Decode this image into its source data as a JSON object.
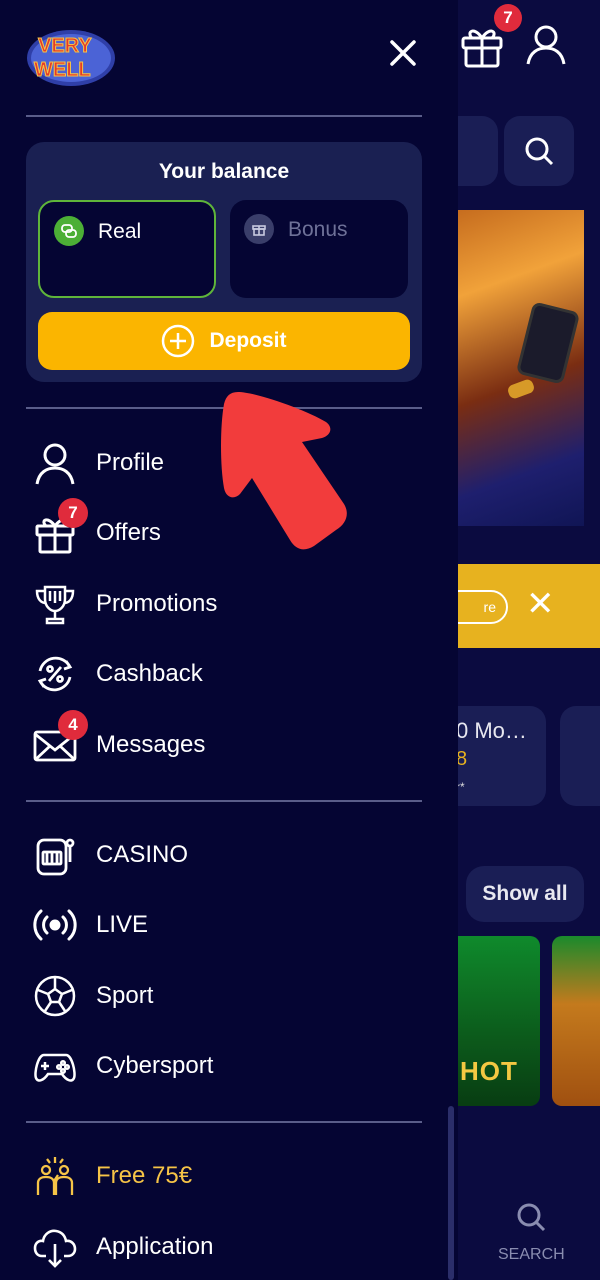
{
  "background": {
    "header": {
      "gift_badge": "7"
    },
    "promo": {
      "pill_text": "re"
    },
    "game_card": {
      "title": "0 Mo…",
      "value": "8",
      "note": "r*"
    },
    "show_all": "Show all",
    "game_tile_text": "HOT",
    "bottom_nav": {
      "search_label": "SEARCH"
    }
  },
  "drawer": {
    "logo_text": "VERY WELL",
    "balance": {
      "title": "Your balance",
      "real_label": "Real",
      "bonus_label": "Bonus",
      "deposit_label": "Deposit"
    },
    "menu_account": [
      {
        "label": "Profile",
        "icon": "user-icon"
      },
      {
        "label": "Offers",
        "icon": "gift-icon",
        "badge": "7"
      },
      {
        "label": "Promotions",
        "icon": "trophy-icon"
      },
      {
        "label": "Cashback",
        "icon": "cashback-icon"
      },
      {
        "label": "Messages",
        "icon": "envelope-icon",
        "badge": "4"
      }
    ],
    "menu_sections": [
      {
        "label": "CASINO",
        "icon": "slot-machine-icon"
      },
      {
        "label": "LIVE",
        "icon": "broadcast-icon"
      },
      {
        "label": "Sport",
        "icon": "soccer-ball-icon"
      },
      {
        "label": "Cybersport",
        "icon": "gamepad-icon"
      }
    ],
    "menu_extra": [
      {
        "label": "Free 75€",
        "icon": "celebration-icon"
      },
      {
        "label": "Application",
        "icon": "cloud-download-icon"
      }
    ]
  },
  "colors": {
    "drawer_bg": "#050533",
    "card_bg": "#1a2052",
    "deposit": "#fbb500",
    "real_border": "#5fb53a",
    "badge": "#e02b3c",
    "gold_text": "#f6c447",
    "arrow": "#f23c3c"
  }
}
